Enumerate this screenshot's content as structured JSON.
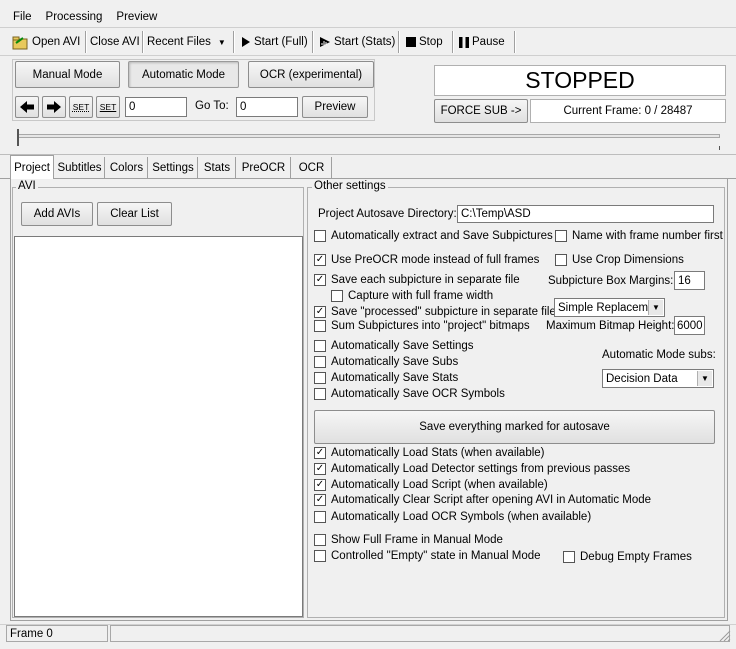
{
  "menu": {
    "file": "File",
    "processing": "Processing",
    "preview": "Preview"
  },
  "toolbar": {
    "open_avi": "Open AVI",
    "close_avi": "Close AVI",
    "recent_files": "Recent Files",
    "start_full": "Start (Full)",
    "start_stats": "Start (Stats)",
    "stop": "Stop",
    "pause": "Pause"
  },
  "modes": {
    "manual": "Manual Mode",
    "automatic": "Automatic Mode",
    "ocr": "OCR (experimental)"
  },
  "nav": {
    "set1": "SET",
    "set2": "SET",
    "frame_value": "0",
    "goto_label": "Go To:",
    "goto_value": "0",
    "preview": "Preview"
  },
  "status": {
    "state": "STOPPED",
    "force_sub": "FORCE SUB ->",
    "current_frame": "Current Frame: 0 / 28487"
  },
  "tabs": [
    "Project",
    "Subtitles",
    "Colors",
    "Settings",
    "Stats",
    "PreOCR",
    "OCR"
  ],
  "avi": {
    "title": "AVI",
    "add": "Add AVIs",
    "clear": "Clear List"
  },
  "other": {
    "title": "Other settings",
    "autosave_dir_label": "Project Autosave Directory:",
    "autosave_dir_value": "C:\\Temp\\ASD",
    "extract_save": "Automatically extract and Save Subpictures",
    "name_frame_first": "Name with frame number first",
    "use_preocr": "Use PreOCR mode instead of full frames",
    "use_crop": "Use Crop Dimensions",
    "save_each": "Save each subpicture in separate file",
    "box_margins_label": "Subpicture Box Margins:",
    "box_margins_value": "16",
    "capture_full": "Capture with full frame width",
    "save_processed": "Save \"processed\" subpicture in separate file",
    "replace_combo": "Simple Replaceme",
    "sum_subpictures": "Sum Subpictures into \"project\" bitmaps",
    "max_height_label": "Maximum Bitmap Height:",
    "max_height_value": "6000",
    "auto_save_settings": "Automatically Save Settings",
    "auto_save_subs": "Automatically Save Subs",
    "auto_save_stats": "Automatically Save Stats",
    "auto_save_ocr": "Automatically Save OCR Symbols",
    "auto_mode_subs_label": "Automatic Mode subs:",
    "auto_mode_subs_value": "Decision Data",
    "save_everything": "Save everything marked for autosave",
    "load_stats": "Automatically Load Stats (when available)",
    "load_detector": "Automatically Load Detector settings from previous passes",
    "load_script": "Automatically Load Script (when available)",
    "clear_script": "Automatically Clear Script after opening AVI in Automatic Mode",
    "load_ocr": "Automatically Load OCR Symbols (when available)",
    "show_full": "Show Full Frame in Manual Mode",
    "controlled_empty": "Controlled \"Empty\" state in Manual Mode",
    "debug_empty": "Debug Empty Frames"
  },
  "statusbar": {
    "frame": "Frame 0"
  }
}
